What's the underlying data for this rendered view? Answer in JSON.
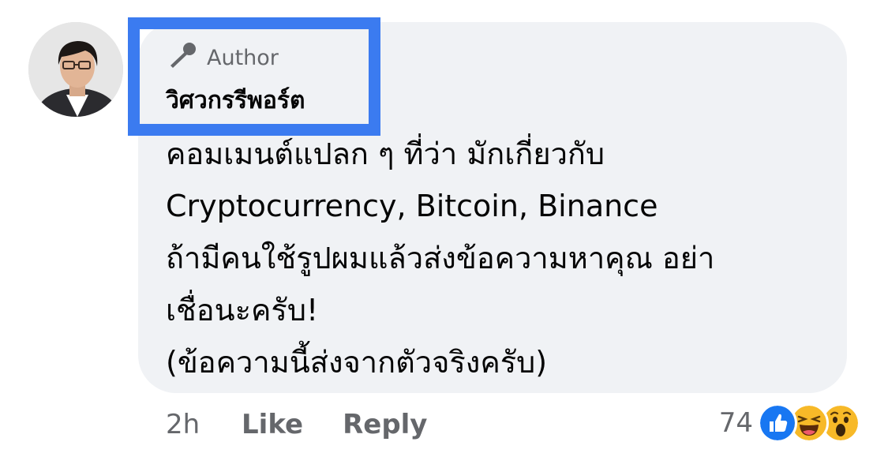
{
  "comment": {
    "author_badge": "Author",
    "author_name": "วิศวกรรีพอร์ต",
    "lines": [
      "คอมเมนต์แปลก ๆ ที่ว่า มักเกี่ยวกับ",
      "Cryptocurrency, Bitcoin, Binance",
      "ถ้ามีคนใช้รูปผมแล้วส่งข้อความหาคุณ อย่า",
      "เชื่อนะครับ!",
      "(ข้อความนี้ส่งจากตัวจริงครับ)"
    ],
    "time": "2h",
    "like_label": "Like",
    "reply_label": "Reply",
    "reaction_count": "74",
    "reactions": [
      "like-icon",
      "haha-icon",
      "wow-icon"
    ]
  },
  "colors": {
    "bubble": "#f0f2f5",
    "highlight": "#3b7bf0",
    "secondary_text": "#65676b",
    "like_blue": "#1877f2",
    "emoji_yellow": "#f7b928"
  }
}
